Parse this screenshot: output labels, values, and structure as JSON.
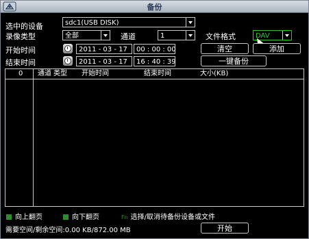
{
  "window": {
    "title": "备份"
  },
  "form": {
    "device_label": "选中的设备",
    "device_value": "sdc1(USB DISK)",
    "record_type_label": "录像类型",
    "record_type_value": "全部",
    "channel_label": "通道",
    "channel_value": "1",
    "file_format_label": "文件格式",
    "file_format_value": "DAV",
    "start_time_label": "开始时间",
    "start_date": "2011 - 03 - 17",
    "start_time": "00 : 00 : 00",
    "end_time_label": "结束时间",
    "end_date": "2011 - 03 - 17",
    "end_time": "16 : 40 : 39"
  },
  "buttons": {
    "clear": "清空",
    "add": "添加",
    "one_key_backup": "一键备份",
    "start": "开始"
  },
  "table": {
    "headers": {
      "index": "0",
      "channel": "通道",
      "type": "类型",
      "start_time": "开始时间",
      "end_time": "结束时间",
      "size": "大小(KB)"
    },
    "rows": []
  },
  "legend": {
    "prev_page": "向上翻页",
    "next_page": "向下翻页",
    "select_toggle": "选择/取消待备份设备或文件",
    "key_labels": {
      "prev": "",
      "next": "",
      "fn": "Fn"
    }
  },
  "status": {
    "space": "需要空间/剩余空间:0.00 KB/872.00 MB"
  },
  "colors": {
    "accent_green": "#2e8b2e",
    "format_green": "#36c136",
    "border": "#c9c9c9"
  }
}
